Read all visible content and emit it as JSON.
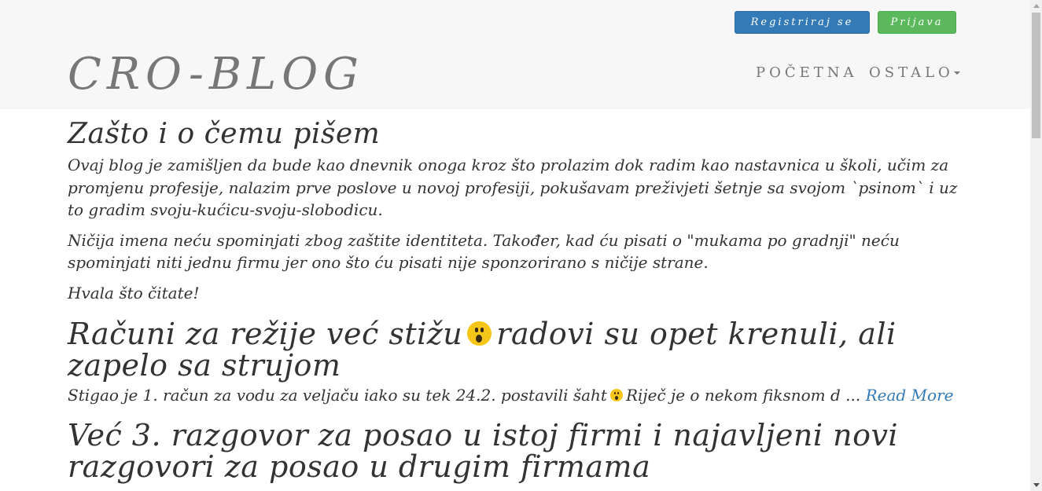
{
  "header": {
    "register_label": "Registriraj se",
    "login_label": "Prijava",
    "brand": "CRO-BLOG",
    "nav": {
      "home": "POČETNA",
      "other": "OSTALO"
    }
  },
  "intro": {
    "title": "Zašto i o čemu pišem",
    "paragraphs": [
      "Ovaj blog je zamišljen da bude kao dnevnik onoga kroz što prolazim dok radim kao nastavnica u školi, učim za promjenu profesije, nalazim prve poslove u novoj profesiji, pokušavam preživjeti šetnje sa svojom `psinom` i uz to gradim svoju-kućicu-svoju-slobodicu.",
      "Ničija imena neću spominjati zbog zaštite identiteta. Također, kad ću pisati o \"mukama po gradnji\" neću spominjati niti jednu firmu jer ono što ću pisati nije sponzorirano s ničije strane.",
      "Hvala što čitate!"
    ]
  },
  "posts": [
    {
      "title_before": "Računi za režije već stižu",
      "title_after": "radovi su opet krenuli, ali zapelo sa strujom",
      "title_emoji": "astonished-face-icon",
      "excerpt_before": "Stigao je 1. račun za vodu za veljaču iako su tek 24.2. postavili šaht",
      "excerpt_after": "Riječ je o nekom fiksnom d ...",
      "excerpt_emoji": "astonished-face-icon",
      "read_more": "Read More"
    },
    {
      "title": "Već 3. razgovor za posao u istoj firmi i najavljeni novi razgovori za posao u drugim firmama"
    }
  ],
  "colors": {
    "register_button": "#337ab7",
    "login_button": "#5cb85c",
    "header_bg": "#f7f7f7",
    "link": "#337ab7",
    "brand": "#777777"
  }
}
